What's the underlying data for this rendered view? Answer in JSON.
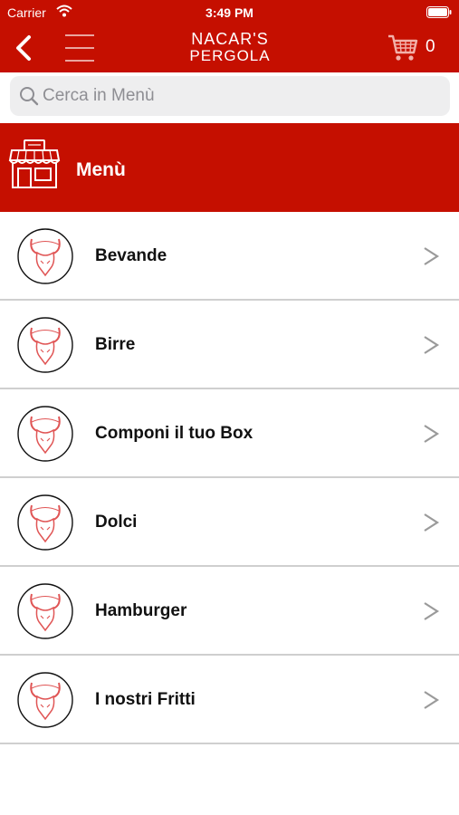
{
  "status_bar": {
    "carrier": "Carrier",
    "time": "3:49 PM"
  },
  "nav": {
    "brand_line1": "NACAR'S",
    "brand_line2": "PERGOLA",
    "cart_count": "0"
  },
  "search": {
    "placeholder": "Cerca in Menù",
    "value": ""
  },
  "section": {
    "title": "Menù"
  },
  "categories": [
    {
      "label": "Bevande"
    },
    {
      "label": "Birre"
    },
    {
      "label": "Componi il tuo Box"
    },
    {
      "label": "Dolci"
    },
    {
      "label": "Hamburger"
    },
    {
      "label": "I nostri Fritti"
    }
  ],
  "colors": {
    "brand_red": "#c50f00",
    "divider": "#cfcfcf",
    "chevron": "#9a9a9a"
  },
  "icons": {
    "back": "back-arrow-icon",
    "menu": "hamburger-menu-icon",
    "cart": "shopping-cart-icon",
    "search": "search-icon",
    "store": "store-icon",
    "row_thumb": "bull-logo-icon",
    "row_chevron": "chevron-right-icon"
  }
}
